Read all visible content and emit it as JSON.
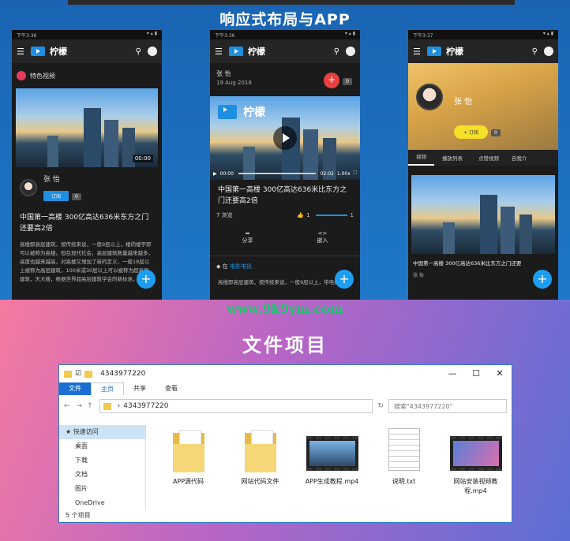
{
  "section1_title": "响应式布局与APP",
  "app_name": "柠檬",
  "phones": [
    {
      "time": "下午3:36",
      "section": "特色视频",
      "duration": "00:00",
      "channel": "张 怡",
      "subscribe": "订阅",
      "count": "0",
      "title": "中国第一高楼 300亿高达636米东方之门还要高2倍",
      "desc": "高楼即高层建筑，按传统来说，一般9层以上，楼的楼宇即可以被称为高楼。但在现代社会，高层建筑数量越来越多，高度也越来越高，对高楼又增加了新的定义，一般18层以上被称为高层建筑，100米或30层以上可以被称为超高层建筑，天大楼，根据世界超高层建筑学会的新标准，300",
      "fab": "+"
    },
    {
      "time": "下午3:36",
      "channel": "张 怡",
      "date": "19 Aug 2018",
      "count": "0",
      "cur": "00:00",
      "total": "02:02",
      "speed": "1.00x",
      "title": "中国第一高楼 300亿高达636米比东方之门还要高2倍",
      "views": "7 浏览",
      "likes": "1",
      "dislikes": "1",
      "share": "分享",
      "embed": "嵌入",
      "category": "电影电视",
      "desc": "高楼即高层建筑，按传统来说，一般9层以上，带电梯的楼",
      "fab": "+"
    },
    {
      "time": "下午3:37",
      "channel": "张 怡",
      "subscribe": "+ 订阅",
      "count": "0",
      "tabs": [
        "视频",
        "播放列表",
        "点赞视频",
        "自我介"
      ],
      "title": "中国第一高楼 300亿高达636米比东方之门还要",
      "meta": "张 怡",
      "fab": "+"
    }
  ],
  "watermark": "www.9k9ym.com",
  "section2_title": "文件项目",
  "explorer": {
    "title": "4343977220",
    "tabs": [
      "文件",
      "主页",
      "共享",
      "查看"
    ],
    "path": "4343977220",
    "search_placeholder": "搜索\"4343977220\"",
    "sidebar": [
      "快速访问",
      "桌面",
      "下载",
      "文档",
      "图片",
      "OneDrive"
    ],
    "files": [
      "APP源代码",
      "网站代码文件",
      "APP生成教程.mp4",
      "说明.txt",
      "网站安装视频教程.mp4"
    ],
    "status": "5 个项目"
  },
  "colors": {
    "accent": "#1e8ee0",
    "fab": "#1e9ef0",
    "red": "#e94040"
  }
}
